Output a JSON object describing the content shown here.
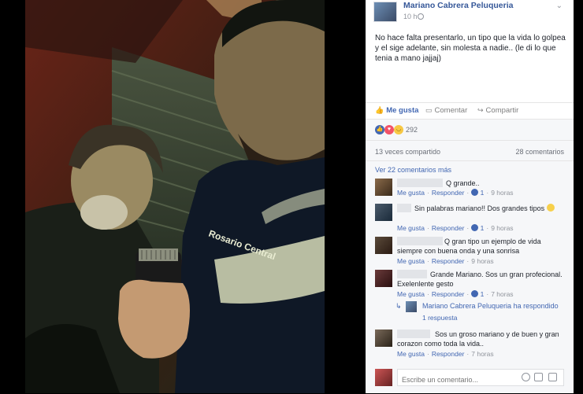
{
  "post": {
    "page_name": "Mariano Cabrera Peluqueria",
    "time": "10 h",
    "text": "No hace falta presentarlo, un tipo que la vida lo golpea y el sige adelante, sin molesta a nadie.. (le di lo que tenia a mano jajjaj)"
  },
  "actions": {
    "like": "Me gusta",
    "comment": "Comentar",
    "share": "Compartir"
  },
  "reactions": {
    "count": "292"
  },
  "stats": {
    "shares": "13 veces compartido",
    "comments": "28 comentarios"
  },
  "comments_section": {
    "view_more": "Ver 22 comentarios más",
    "comments": [
      {
        "text": "Q grande..",
        "like": "Me gusta",
        "reply": "Responder",
        "likes": "1",
        "time": "9 horas"
      },
      {
        "text": "Sin palabras mariano!! Dos grandes tipos",
        "like": "Me gusta",
        "reply": "Responder",
        "likes": "1",
        "time": "9 horas"
      },
      {
        "text": "Q gran tipo un ejemplo de vida siempre con buena onda y una sonrisa",
        "like": "Me gusta",
        "reply": "Responder",
        "time": "9 horas"
      },
      {
        "text": "Grande Mariano. Sos un gran profecional. Exelenlente gesto",
        "like": "Me gusta",
        "reply": "Responder",
        "likes": "1",
        "time": "7 horas"
      },
      {
        "text": "Sos un groso mariano y de buen y gran corazon como toda la vida..",
        "like": "Me gusta",
        "reply": "Responder",
        "time": "7 horas"
      }
    ],
    "reply_notice": "Mariano Cabrera Peluqueria ha respondido",
    "reply_count": "1 respuesta"
  },
  "composer": {
    "placeholder": "Escribe un comentario..."
  },
  "photo": {
    "jacket_text": "Rosario Central"
  },
  "colors": {
    "link": "#365899",
    "accent": "#4267b2"
  }
}
